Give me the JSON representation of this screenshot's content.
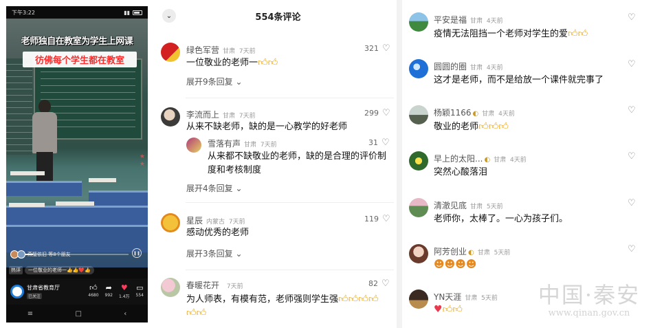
{
  "video": {
    "status_time": "下午3:22",
    "title": "老师独自在教室为学生上网课",
    "subtitle": "彷佛每个学生都在教室",
    "friends_text": "燕璧依旧 等8个朋友",
    "hot_tag": "热评",
    "danmu": "一位敬业的老师一👍👍❤️👍",
    "account_name": "甘肃省教育厅",
    "follow_label": "已关注",
    "likes": "4680",
    "shares": "992",
    "hearts": "1.4万",
    "comments": "554",
    "progress": 0.18,
    "icons": {
      "play": "pause-icon",
      "like": "thumb-up-icon",
      "share": "share-icon",
      "heart": "heart-icon",
      "comment": "comment-icon"
    }
  },
  "comments_panel": {
    "title": "554条评论",
    "items": [
      {
        "name": "绿色军营",
        "location": "甘肃",
        "time": "7天前",
        "likes": "321",
        "text": "一位敬业的老师一",
        "expand": "展开9条回复"
      },
      {
        "name": "李流而上",
        "location": "甘肃",
        "time": "7天前",
        "likes": "299",
        "text": "从来不缺老师，缺的是一心教学的好老师",
        "expand": "展开4条回复",
        "reply": {
          "name": "雪落有声",
          "location": "甘肃",
          "time": "7天前",
          "likes": "31",
          "text_line1": "从来都不缺敬业的老师，缺的是合理的评价制",
          "text_line2": "度和考核制度"
        }
      },
      {
        "name": "星辰",
        "location": "内蒙古",
        "time": "7天前",
        "likes": "119",
        "text": "感动优秀的老师",
        "expand": "展开3条回复"
      },
      {
        "name": "春暖花开",
        "location": "",
        "time": "7天前",
        "likes": "82",
        "text": "为人师表，有模有范，老师强则学生强"
      }
    ]
  },
  "comments_right": {
    "items": [
      {
        "name": "平安是福",
        "location": "甘肃",
        "time": "4天前",
        "text": "疫情无法阻挡一个老师对学生的爱"
      },
      {
        "name": "圆圆的圈",
        "location": "甘肃",
        "time": "4天前",
        "text": "这才是老师，而不是给放一个课件就完事了"
      },
      {
        "name": "杨颖1166",
        "location": "甘肃",
        "time": "4天前",
        "text": "敬业的老师"
      },
      {
        "name": "早上的太阳...",
        "location": "甘肃",
        "time": "4天前",
        "text": "突然心酸落泪"
      },
      {
        "name": "清澈见底",
        "location": "甘肃",
        "time": "5天前",
        "text": "老师你，太棒了。一心为孩子们。"
      },
      {
        "name": "阿芳创业",
        "location": "甘肃",
        "time": "5天前",
        "text": ""
      },
      {
        "name": "YN天涯",
        "location": "甘肃",
        "time": "5天前",
        "text": ""
      }
    ]
  },
  "watermark": {
    "cn": "中国·秦安",
    "url": "www.qinan.gov.cn"
  },
  "colors": {
    "accent_heart": "#ff3b5c",
    "video_subtitle": "#ff2a2a",
    "link_gray": "#555555"
  }
}
